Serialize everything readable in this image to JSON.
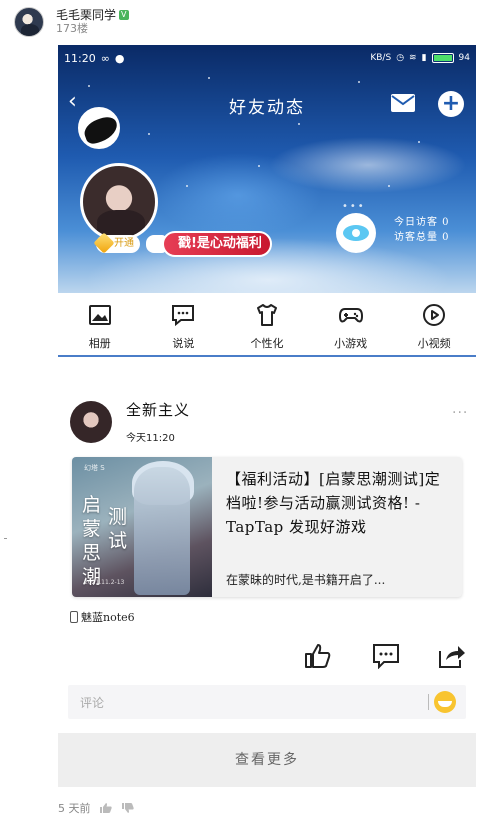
{
  "post": {
    "username": "毛毛栗同学",
    "level_badge": "V",
    "floor": "173楼",
    "time_ago": "5 天前"
  },
  "status_bar": {
    "time": "11:20",
    "net_speed": "KB/S",
    "battery": "94"
  },
  "nav": {
    "back_glyph": "‹",
    "title": "好友动态",
    "add_glyph": "+"
  },
  "profile": {
    "vip_label": "开通",
    "promo_label": "戳!是心动福利",
    "today_visitors": "今日访客 0",
    "total_visitors": "访客总量 0"
  },
  "features": [
    {
      "label": "相册",
      "icon": "photo-icon"
    },
    {
      "label": "说说",
      "icon": "speech-icon"
    },
    {
      "label": "个性化",
      "icon": "shirt-icon"
    },
    {
      "label": "小游戏",
      "icon": "gamepad-icon"
    },
    {
      "label": "小视频",
      "icon": "play-icon"
    }
  ],
  "feed": {
    "author": "全新主义",
    "time": "今天11:20",
    "more": "···",
    "card": {
      "game_tag": "幻塔 S",
      "game_title_1": "启蒙",
      "game_title_2": "思潮",
      "game_title_3": "测试",
      "title": "【福利活动】[启蒙思潮测试]定档啦!参与活动赢测试资格! - TapTap 发现好游戏",
      "subtitle": "在蒙昧的时代,是书籍开启了..."
    },
    "device": "魅蓝note6",
    "comment_placeholder": "评论",
    "view_more": "查看更多"
  },
  "colors": {
    "accent_blue": "#4a7dc8",
    "promo_red": "#d62a42",
    "eye_blue": "#5bc7f2"
  }
}
